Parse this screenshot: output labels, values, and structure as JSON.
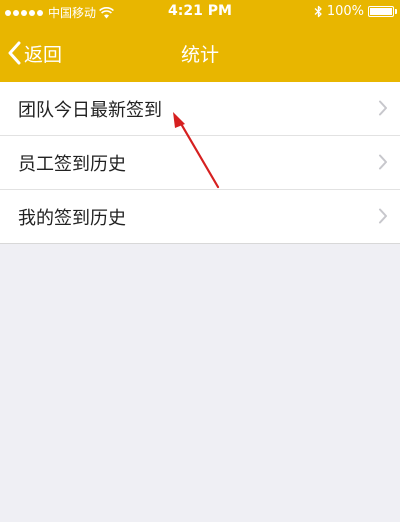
{
  "status_bar": {
    "carrier": "中国移动",
    "time": "4:21 PM",
    "battery": "100%",
    "battery_level": 1.0,
    "wifi_icon": "wifi-icon",
    "bluetooth_icon": "bluetooth-icon"
  },
  "nav": {
    "back_label": "返回",
    "title": "统计"
  },
  "menu": {
    "items": [
      {
        "label": "团队今日最新签到",
        "icon": "chevron-right-icon"
      },
      {
        "label": "员工签到历史",
        "icon": "chevron-right-icon"
      },
      {
        "label": "我的签到历史",
        "icon": "chevron-right-icon"
      }
    ]
  },
  "colors": {
    "accent": "#e8b600",
    "background": "#efeff4",
    "annotation": "#d62020"
  }
}
